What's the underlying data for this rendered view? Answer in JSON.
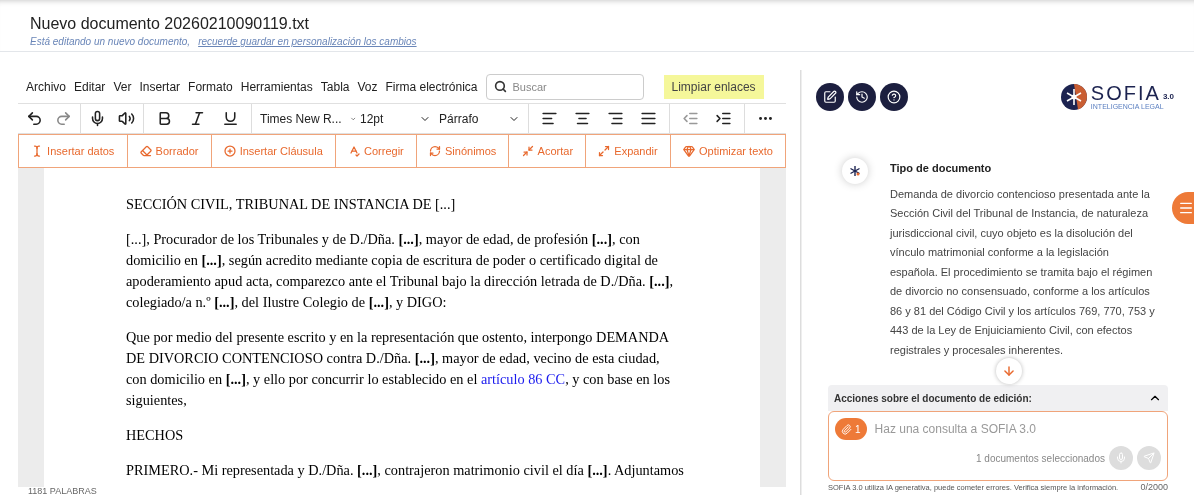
{
  "header": {
    "title": "Nuevo documento 20260210090119.txt",
    "subtitle": "Está editando un nuevo documento,",
    "subtitle_link": "recuerde guardar en personalización los cambios"
  },
  "menu": [
    "Archivo",
    "Editar",
    "Ver",
    "Insertar",
    "Formato",
    "Herramientas",
    "Tabla",
    "Voz",
    "Firma electrónica"
  ],
  "search": {
    "placeholder": "Buscar"
  },
  "clear_links": "Limpiar enlaces",
  "toolbar": {
    "font": "Times New R...",
    "size": "12pt",
    "block": "Párrafo"
  },
  "actions": [
    {
      "kind": "cursor",
      "label": "Insertar datos"
    },
    {
      "kind": "eraser",
      "label": "Borrador"
    },
    {
      "kind": "plus",
      "label": "Insertar Cláusula"
    },
    {
      "kind": "spell",
      "label": "Corregir"
    },
    {
      "kind": "sync",
      "label": "Sinónimos"
    },
    {
      "kind": "shrink",
      "label": "Acortar"
    },
    {
      "kind": "expand",
      "label": "Expandir"
    },
    {
      "kind": "gem",
      "label": "Optimizar texto"
    }
  ],
  "document": [
    {
      "segments": [
        {
          "kind": "text",
          "text": "SECCIÓN CIVIL, TRIBUNAL DE INSTANCIA DE [...]"
        }
      ]
    },
    {
      "segments": [
        {
          "kind": "text",
          "text": "[...], Procurador de los Tribunales y de D./Dña. **[...]**, mayor de edad, de profesión **[...]**, con domicilio en **[...]**, según acredito mediante copia de escritura de poder o certificado digital de apoderamiento apud acta, comparezco ante el Tribunal bajo la dirección letrada de D./Dña. **[...]**, colegiado/a n.º **[...]**, del Ilustre Colegio de **[...]**, y DIGO:"
        }
      ]
    },
    {
      "segments": [
        {
          "kind": "text",
          "text": "Que por medio del presente escrito y en la representación que ostento, interpongo DEMANDA DE DIVORCIO CONTENCIOSO contra D./Dña. **[...]**, mayor de edad, vecino de esta ciudad, con domicilio en **[...]**, y ello por concurrir lo establecido en el "
        },
        {
          "kind": "link",
          "text": "artículo 86 CC"
        },
        {
          "kind": "text",
          "text": ", y con base en los siguientes,"
        }
      ]
    },
    {
      "segments": [
        {
          "kind": "text",
          "text": "HECHOS"
        }
      ]
    },
    {
      "segments": [
        {
          "kind": "text",
          "text": "PRIMERO.- Mi representada y D./Dña. **[...]**, contrajeron matrimonio civil el día **[...]**. Adjuntamos"
        }
      ]
    }
  ],
  "word_count": "1181 PALABRAS",
  "assistant": {
    "logo": "SOFIA",
    "logo_version": "3.0",
    "logo_tagline": "INTELIGENCIA LEGAL",
    "card_title": "Tipo de documento",
    "card_text": "Demanda de divorcio contencioso presentada ante la Sección Civil del Tribunal de Instancia, de naturaleza jurisdiccional civil, cuyo objeto es la disolución del vínculo matrimonial conforme a la legislación española. El procedimiento se tramita bajo el régimen de divorcio no consensuado, conforme a los artículos 86 y 81 del Código Civil y los artículos 769, 770, 753 y 443 de la Ley de Enjuiciamiento Civil, con efectos registrales y procesales inherentes.",
    "actions_title": "Acciones sobre el documento de edición:",
    "actions_expanded": false,
    "attach_count": "1",
    "query_placeholder": "Haz una consulta a SOFIA 3.0",
    "selected_docs": "1 documentos seleccionados",
    "disclaimer": "SOFIA 3.0 utiliza IA generativa, puede cometer errores. Verifica siempre la información.",
    "counter": "0/2000"
  }
}
